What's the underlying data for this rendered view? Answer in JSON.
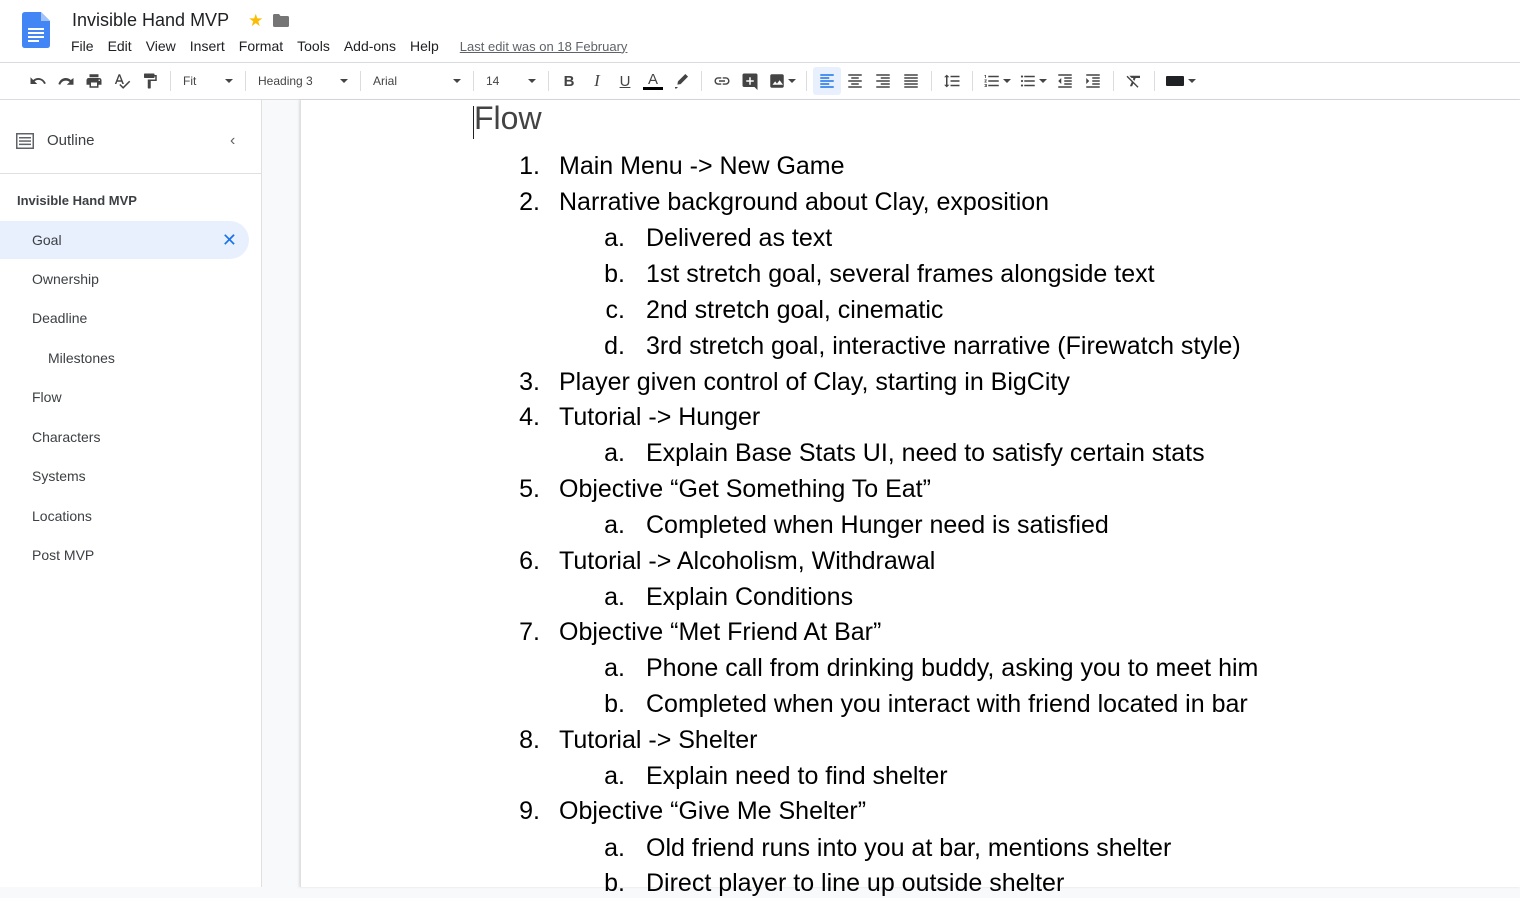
{
  "app": {
    "doc_title": "Invisible Hand MVP",
    "last_edit": "Last edit was on 18 February",
    "colors": {
      "accent": "#1a73e8",
      "star": "#fbbc04",
      "doc_icon": "#4285f4"
    }
  },
  "menu": [
    "File",
    "Edit",
    "View",
    "Insert",
    "Format",
    "Tools",
    "Add-ons",
    "Help"
  ],
  "toolbar": {
    "zoom": "Fit",
    "style": "Heading 3",
    "font": "Arial",
    "size": "14",
    "bold": "B",
    "italic": "I",
    "underline": "U",
    "text_color": "A"
  },
  "outline": {
    "label": "Outline",
    "doc_title": "Invisible Hand MVP",
    "items": [
      {
        "label": "Goal",
        "selected": true
      },
      {
        "label": "Ownership"
      },
      {
        "label": "Deadline"
      },
      {
        "label": "Milestones"
      },
      {
        "label": "Flow"
      },
      {
        "label": "Characters"
      },
      {
        "label": "Systems"
      },
      {
        "label": "Locations"
      },
      {
        "label": "Post MVP"
      }
    ]
  },
  "document": {
    "heading": "Flow",
    "lines": [
      {
        "n": "1.",
        "t": "Main Menu -> New Game"
      },
      {
        "n": "2.",
        "t": "Narrative background about Clay, exposition"
      },
      {
        "n": "a.",
        "t": "Delivered as text"
      },
      {
        "n": "b.",
        "t": "1st stretch goal, several frames alongside text"
      },
      {
        "n": "c.",
        "t": "2nd stretch goal, cinematic"
      },
      {
        "n": "d.",
        "t": "3rd stretch goal, interactive narrative (Firewatch style)"
      },
      {
        "n": "3.",
        "t": "Player given control of Clay, starting in BigCity"
      },
      {
        "n": "4.",
        "t": "Tutorial -> Hunger"
      },
      {
        "n": "a.",
        "t": "Explain Base Stats UI, need to satisfy certain stats"
      },
      {
        "n": "5.",
        "t": "Objective “Get Something To Eat”"
      },
      {
        "n": "a.",
        "t": "Completed when Hunger need is satisfied"
      },
      {
        "n": "6.",
        "t": "Tutorial -> Alcoholism, Withdrawal"
      },
      {
        "n": "a.",
        "t": "Explain Conditions"
      },
      {
        "n": "7.",
        "t": "Objective “Met Friend At Bar”"
      },
      {
        "n": "a.",
        "t": "Phone call from drinking buddy, asking you to meet him"
      },
      {
        "n": "b.",
        "t": "Completed when you interact with friend located in bar"
      },
      {
        "n": "8.",
        "t": "Tutorial -> Shelter"
      },
      {
        "n": "a.",
        "t": "Explain need to find shelter"
      },
      {
        "n": "9.",
        "t": "Objective “Give Me Shelter”"
      },
      {
        "n": "a.",
        "t": "Old friend runs into you at bar, mentions shelter"
      },
      {
        "n": "b.",
        "t": "Direct player to line up outside shelter"
      }
    ]
  }
}
